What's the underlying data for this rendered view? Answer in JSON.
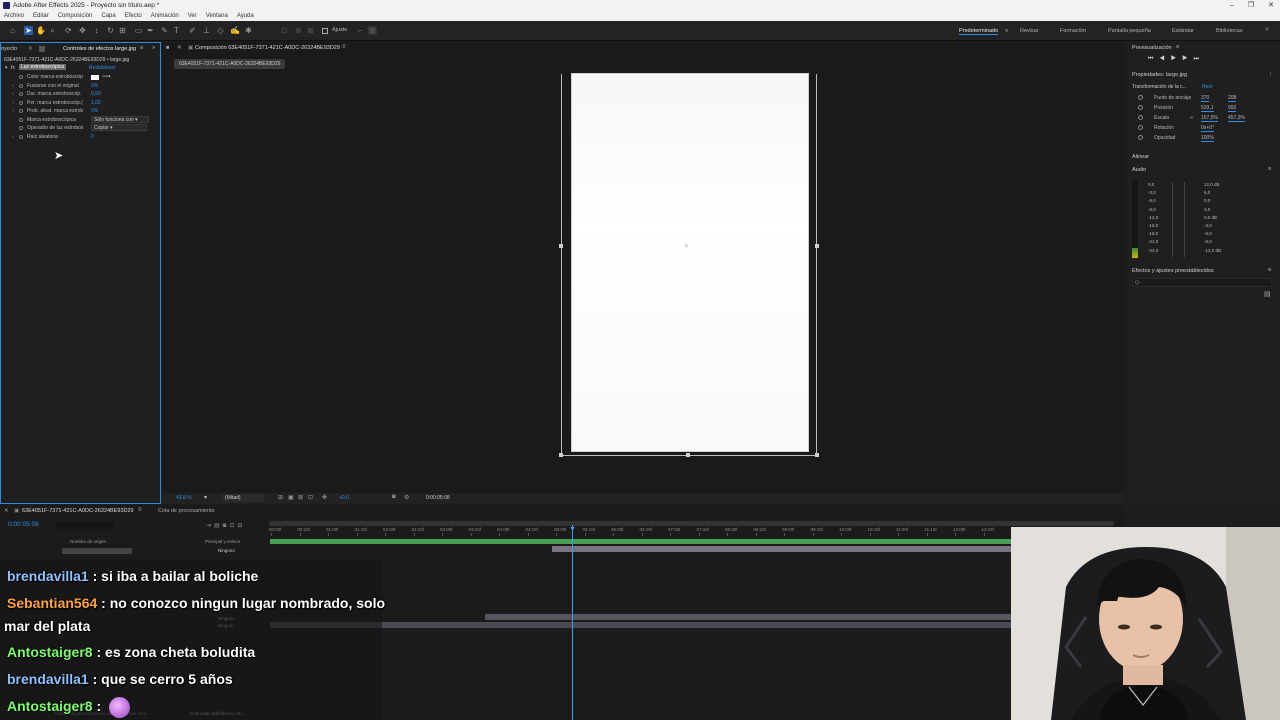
{
  "window": {
    "title": "Adobe After Effects 2025 - Proyecto sin título.aep *"
  },
  "menu": [
    "Archivo",
    "Editar",
    "Composición",
    "Capa",
    "Efecto",
    "Animación",
    "Ver",
    "Ventana",
    "Ayuda"
  ],
  "toolbar": {
    "snap_label": "Ajuste"
  },
  "workspaces": [
    "Predeterminado",
    "Revisar",
    "Formación",
    "Pantalla pequeña",
    "Estándar",
    "Bibliotecas"
  ],
  "left_panel": {
    "tab_project": "oyecto",
    "tab_effects": "Controles de efectos large.jpg",
    "breadcrumb": "63E4051F-7371-421C-A0DC-26324BE93D29 • large.jpg",
    "effect_name": "Luz estroboscópica",
    "reset": "Restablecer",
    "rows": [
      {
        "label": "Color marca estroboscóp",
        "value": ""
      },
      {
        "label": "Fusionar con el original",
        "value": "0%"
      },
      {
        "label": "Dur. marca estroboscóp.",
        "value": "0,50"
      },
      {
        "label": "Per. marca estroboscóp.(",
        "value": "1,00"
      },
      {
        "label": "Prob. aleat. marca estrob",
        "value": "0%"
      },
      {
        "label": "Marca estroboscópica",
        "value": "Sólo funciona con"
      },
      {
        "label": "Operador de luz estrobos",
        "value": "Copiar"
      },
      {
        "label": "Raíz aleatoria",
        "value": "0"
      }
    ]
  },
  "composition": {
    "tab": "Composición 63E4051F-7371-421C-A0DC-26324BE93D29",
    "subtab": "63E4051F-7371-421C-A0DC-26324BE93D29",
    "zoom": "43,8 %",
    "resolution": "(Mitad)",
    "exposure": "+0,0",
    "timecode": "0:00:05:08"
  },
  "right_panel": {
    "preview_title": "Previsualización",
    "props_title": "Propiedades: large.jpg",
    "transform_title": "Transformación de la c...",
    "reset": "Rest",
    "props": [
      {
        "label": "Punto de anclaje",
        "v1": "370",
        "v2": "208"
      },
      {
        "label": "Posición",
        "v1": "533,1",
        "v2": "992"
      },
      {
        "label": "Escala",
        "v1": "157,5%",
        "v2": "457,3%"
      },
      {
        "label": "Rotación",
        "v1": "0x+0°",
        "v2": ""
      },
      {
        "label": "Opacidad",
        "v1": "100%",
        "v2": ""
      }
    ],
    "align_title": "Alinear",
    "audio_title": "Audio",
    "audio_left": [
      "0,0",
      "-3,0",
      "-6,0",
      "-9,0",
      "-12,0",
      "-15,0",
      "-18,0",
      "-21,0",
      "-24,0"
    ],
    "audio_right": [
      "12,0 dB",
      "6,0",
      "0,0",
      "3,0",
      "0,0 dB",
      "-3,0",
      "-6,0",
      "-9,0",
      "-12,0 dB"
    ],
    "effects_title": "Efectos y ajustes preestablecidos",
    "search_placeholder": "Q-"
  },
  "timeline": {
    "tab": "63E4051F-7371-421C-A0DC-26324BE93D29",
    "render_queue": "Cola de procesamiento",
    "timecode": "0:00:05:08",
    "col_source": "Nombre de origen",
    "col_parent": "Principal y enlace",
    "parent_value": "Ninguno",
    "ruler": [
      "00:00f",
      "00:15f",
      "01:00f",
      "01:15f",
      "02:00f",
      "02:15f",
      "03:00f",
      "03:15f",
      "04:00f",
      "04:15f",
      "05:00f",
      "05:15f",
      "06:00f",
      "06:15f",
      "07:00f",
      "07:15f",
      "08:00f",
      "08:15f",
      "09:00f",
      "09:15f",
      "10:00f",
      "10:15f",
      "11:00f",
      "11:15f",
      "12:00f",
      "12:15f"
    ],
    "footer_render": "Tiempo de procesamiento de fotogramas: 1ms",
    "footer_toggle": "Conmutar definidores / m..."
  },
  "chat": [
    {
      "user": "brendavilla1",
      "color": "#8fc1ff",
      "text": "si iba a bailar al boliche"
    },
    {
      "user": "Sebantian564",
      "color": "#ffa43a",
      "text": "no conozco ningun lugar nombrado, solo"
    },
    {
      "user": "",
      "color": "#ffffff",
      "text": "mar del plata"
    },
    {
      "user": "Antostaiger8",
      "color": "#7dff6a",
      "text": "es zona cheta boludita"
    },
    {
      "user": "brendavilla1",
      "color": "#8fc1ff",
      "text": "que se cerro 5 años"
    },
    {
      "user": "Antostaiger8",
      "color": "#7dff6a",
      "text": ""
    }
  ],
  "colors": {
    "accent": "#2d8ceb",
    "playhead": "#3ea0ff",
    "track": "#4a9f58",
    "track2": "#5a5a6a"
  }
}
